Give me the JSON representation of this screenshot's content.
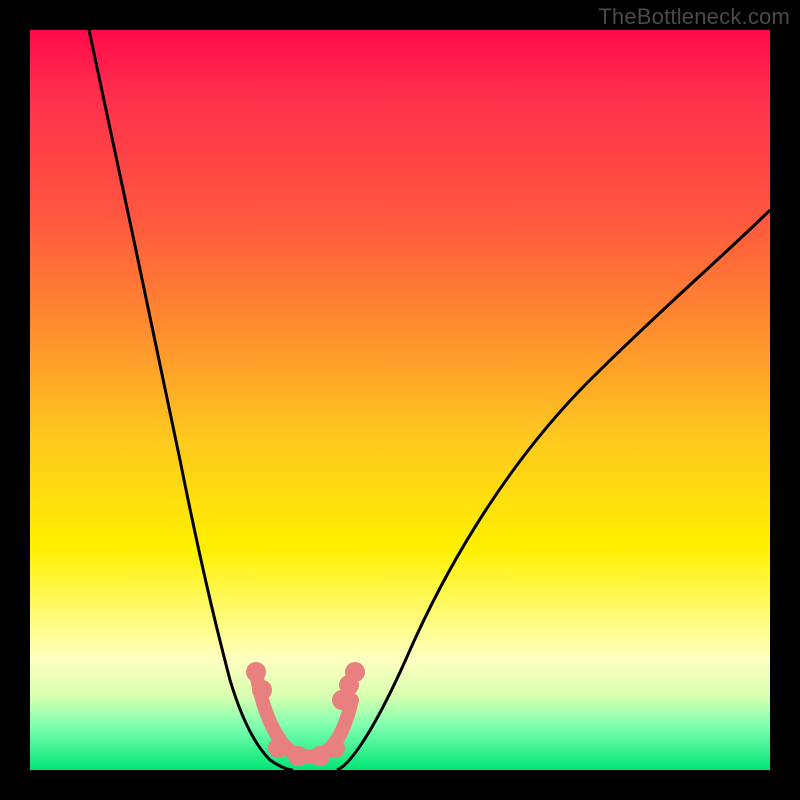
{
  "watermark": "TheBottleneck.com",
  "chart_data": {
    "type": "line",
    "title": "",
    "xlabel": "",
    "ylabel": "",
    "xlim": [
      0,
      1
    ],
    "ylim": [
      0,
      1
    ],
    "annotations": [],
    "series": [
      {
        "name": "left-descent",
        "x": [
          0.08,
          0.12,
          0.16,
          0.2,
          0.24,
          0.26,
          0.275,
          0.29,
          0.305,
          0.32,
          0.335,
          0.35
        ],
        "y": [
          1.0,
          0.81,
          0.62,
          0.43,
          0.24,
          0.17,
          0.12,
          0.09,
          0.06,
          0.035,
          0.015,
          0.0
        ]
      },
      {
        "name": "right-ascent",
        "x": [
          0.42,
          0.45,
          0.5,
          0.56,
          0.64,
          0.72,
          0.8,
          0.88,
          0.96,
          1.0
        ],
        "y": [
          0.0,
          0.04,
          0.13,
          0.26,
          0.41,
          0.53,
          0.625,
          0.7,
          0.755,
          0.78
        ]
      },
      {
        "name": "trough-markers",
        "x": [
          0.305,
          0.315,
          0.335,
          0.36,
          0.39,
          0.41,
          0.42,
          0.43,
          0.44
        ],
        "y": [
          0.13,
          0.11,
          0.03,
          0.02,
          0.02,
          0.03,
          0.095,
          0.115,
          0.135
        ]
      }
    ],
    "colors": {
      "curve": "#000000",
      "markers": "#e98080",
      "gradient_top": "#ff0a4a",
      "gradient_bottom": "#00e676"
    }
  }
}
